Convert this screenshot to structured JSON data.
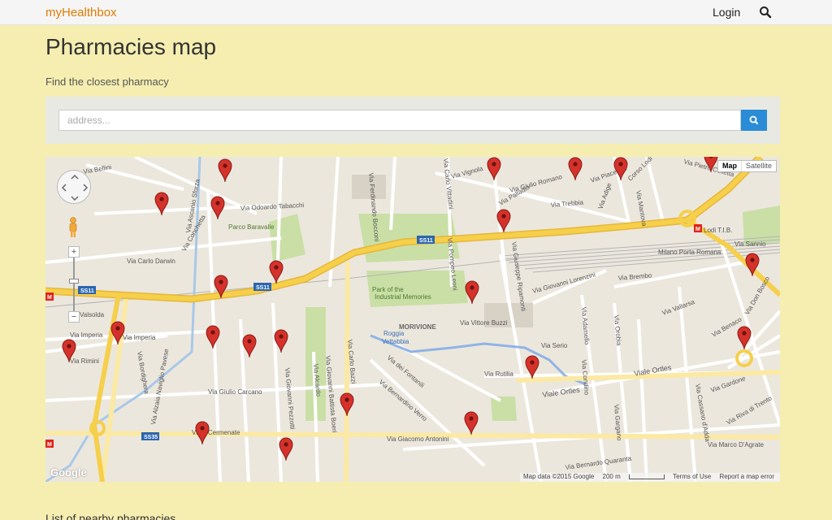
{
  "nav": {
    "brand": "myHealthbox",
    "login_label": "Login"
  },
  "page": {
    "title": "Pharmacies map",
    "subtitle": "Find the closest pharmacy"
  },
  "search": {
    "placeholder": "address..."
  },
  "map": {
    "type_buttons": [
      "Map",
      "Satellite"
    ],
    "active_type": "Map",
    "attribution": {
      "data": "Map data ©2015 Google",
      "scale": "200 m",
      "terms": "Terms of Use",
      "report": "Report a map error"
    },
    "logo": "Google",
    "labels": [
      "Via Odoardo Tabacchi",
      "Parco Baravalle",
      "Via Carlo Darwin",
      "Via Conchetta",
      "Via Ascanio Sforza",
      "Valsolda",
      "Via Imperia",
      "Via Rimini",
      "Via Giulio Carcano",
      "Via Giovanni Pezzotti",
      "Via Alcardo",
      "Via Giovanni Battista Boeri",
      "Via Carlo Bazzi",
      "Roggia Vettabbia",
      "MORIVIONE",
      "Via dei Fontanili",
      "Via Bernardino Verro",
      "Via Giacomo Antonini",
      "Park of the Industrial Memories",
      "Via Vittore Buzzi",
      "Via Giuseppe Ripamonti",
      "Via Pompeo Leoni",
      "Via Carlo Vittadini",
      "Via Vignola",
      "Via Giulio Romano",
      "Via Palladio",
      "Via Trebbia",
      "Via Piacenza",
      "Corso Lodi",
      "Via Giovanni Lorenzini",
      "Via Brembo",
      "Milano Porta Romana",
      "Lodi T.I.B.",
      "Viale Ortles",
      "Via Serio",
      "Via Rutilia",
      "Via Adamello",
      "Via Orobia",
      "Via Condino",
      "Via Gargano",
      "Via Bernardo Quaranta",
      "Via Marco D'Agrate",
      "Via Vallarsa",
      "Via Benaco",
      "Via Don Bosco",
      "Via Gardone",
      "Via Sannio",
      "Via Pietro Colletta",
      "Viale Cermenate",
      "Via Ferdinando Bocconi",
      "Via Bordighera",
      "Via Alzaia Naviglio Pavese",
      "Via Riva di Trento",
      "Via Cassano d'Adda",
      "Via Mantova",
      "Via Adige",
      "Via Bellini"
    ],
    "road_shields": [
      "SS11",
      "SS11",
      "SS35"
    ],
    "marker_color": "#d4322b"
  },
  "list": {
    "heading": "List of nearby pharmacies"
  },
  "colors": {
    "background": "#f5eeb0",
    "brand": "#e07b00",
    "button": "#2a8cd6",
    "highway": "#f6cf4b"
  }
}
